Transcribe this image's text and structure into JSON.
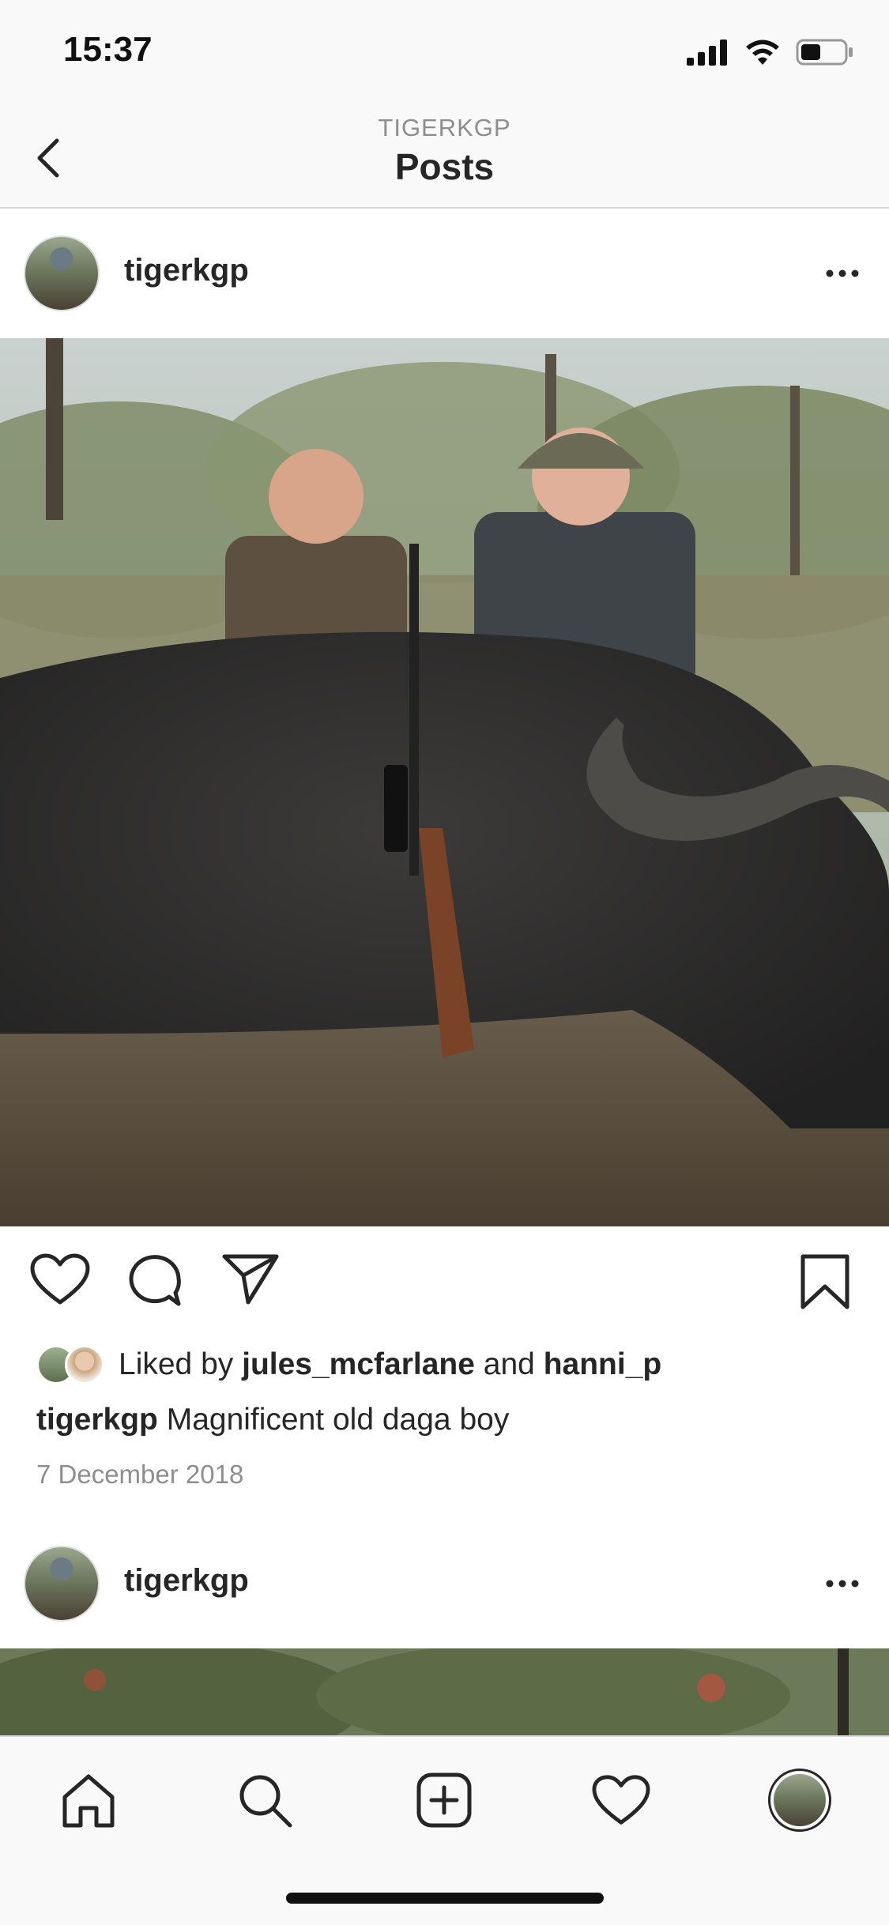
{
  "status_bar": {
    "time": "15:37"
  },
  "nav": {
    "subtitle": "TIGERKGP",
    "title": "Posts"
  },
  "post1": {
    "username": "tigerkgp",
    "liked_by_prefix": "Liked by",
    "liked_by_user1": "jules_mcfarlane",
    "liked_by_and": "and",
    "liked_by_user2": "hanni_p",
    "caption_user": "tigerkgp",
    "caption_text": "Magnificent old daga boy",
    "date": "7 December 2018"
  },
  "post2": {
    "username": "tigerkgp"
  },
  "icons": {
    "back": "chevron-left-icon",
    "more": "more-horizontal-icon",
    "like": "heart-icon",
    "comment": "comment-bubble-icon",
    "share": "paper-plane-icon",
    "save": "bookmark-icon",
    "tab_home": "home-icon",
    "tab_search": "search-icon",
    "tab_add": "plus-square-icon",
    "tab_activity": "heart-icon",
    "tab_profile": "avatar"
  },
  "colors": {
    "text": "#262626",
    "muted": "#8e8e8e",
    "bar_bg": "#f9f9f9"
  }
}
